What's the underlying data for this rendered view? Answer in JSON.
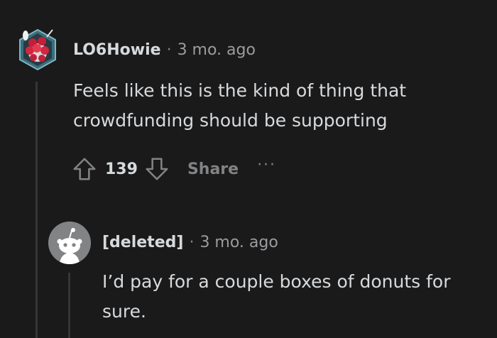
{
  "comment": {
    "author": "LO6Howie",
    "separator": "·",
    "time": "3 mo. ago",
    "body": "Feels like this is the kind of thing that crowdfunding should be supporting",
    "score": "139",
    "share_label": "Share",
    "more_label": "···",
    "avatar_icon": "snoo-avatar-icon",
    "upvote_icon": "arrow-up-icon",
    "downvote_icon": "arrow-down-icon"
  },
  "reply": {
    "author": "[deleted]",
    "separator": "·",
    "time": "3 mo. ago",
    "body": "I’d pay for a couple boxes of donuts for sure.",
    "avatar_icon": "default-snoo-avatar-icon"
  },
  "colors": {
    "background": "#1a1a1b",
    "text": "#d7dadc",
    "muted": "#818384",
    "thread_line": "#343536"
  }
}
